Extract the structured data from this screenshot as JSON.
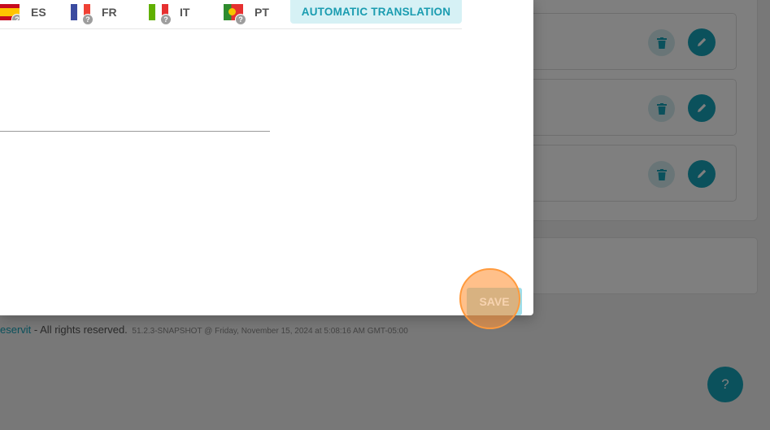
{
  "languages": [
    {
      "code": "ES",
      "status_icon": "?"
    },
    {
      "code": "FR",
      "status_icon": "?"
    },
    {
      "code": "IT",
      "status_icon": "?"
    },
    {
      "code": "PT",
      "status_icon": "?"
    }
  ],
  "modal": {
    "auto_translate_label": "AUTOMATIC TRANSLATION",
    "save_label": "SAVE"
  },
  "footer": {
    "link_text": "eservit",
    "rights": " - All rights reserved.",
    "version": "51.2.3-SNAPSHOT @ Friday, November 15, 2024 at 5:08:16 AM GMT-05:00"
  },
  "help": {
    "label": "?"
  },
  "colors": {
    "accent": "#17a2b8",
    "accent_light": "#d6f1f5",
    "highlight": "#ff9a3d"
  }
}
